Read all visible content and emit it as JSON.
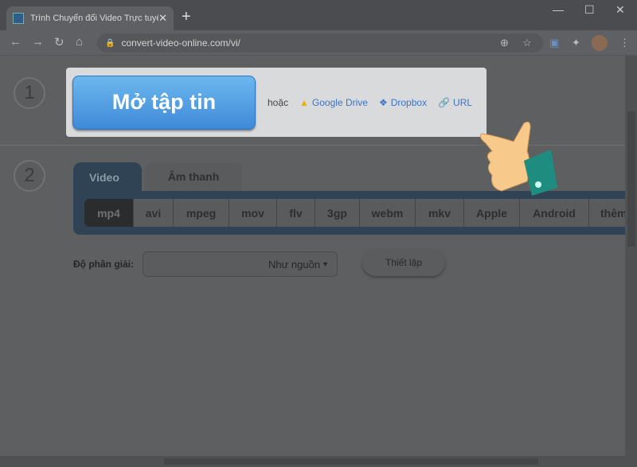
{
  "browser": {
    "tab_title": "Trình Chuyển đổi Video Trực tuyến",
    "url": "convert-video-online.com/vi/"
  },
  "steps": [
    "1",
    "2"
  ],
  "open": {
    "button": "Mở tập tin",
    "or": "hoặc",
    "google_drive": "Google Drive",
    "dropbox": "Dropbox",
    "url": "URL"
  },
  "tabs": [
    "Video",
    "Âm thanh"
  ],
  "formats": [
    "mp4",
    "avi",
    "mpeg",
    "mov",
    "flv",
    "3gp",
    "webm",
    "mkv",
    "Apple",
    "Android",
    "thêm"
  ],
  "resolution": {
    "label": "Độ phân giải:",
    "value": "Như nguồn",
    "settings": "Thiết lập"
  },
  "colors": {
    "open_button": "#3f8ad8",
    "link": "#3b73c9",
    "panel": "#2f4354"
  }
}
